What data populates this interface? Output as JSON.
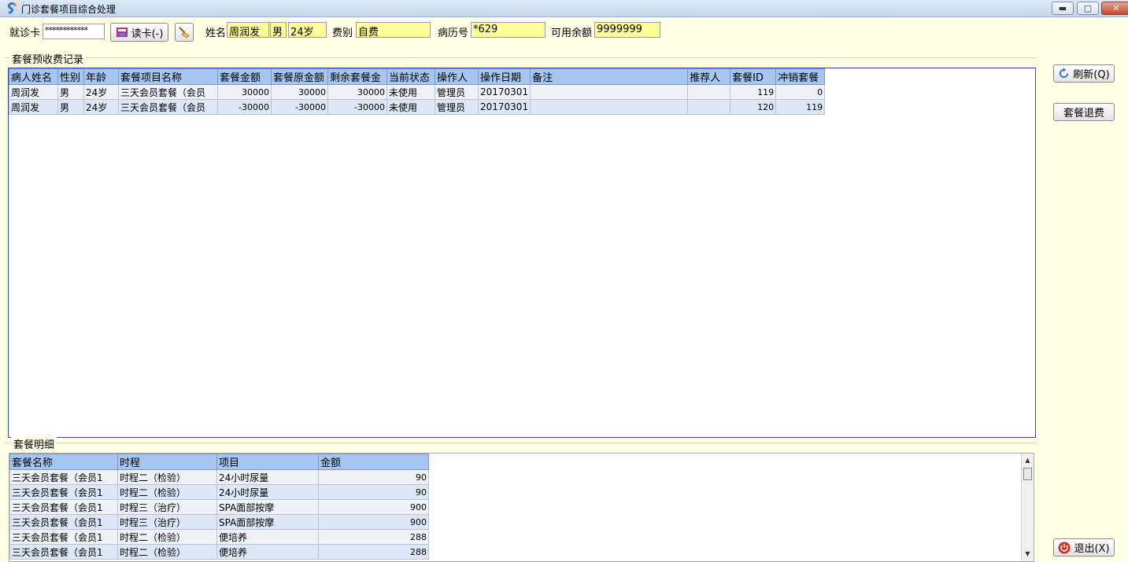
{
  "window": {
    "title": "门诊套餐项目综合处理",
    "minimize_label": "▬",
    "maximize_label": "▢",
    "close_label": "✕"
  },
  "toolbar": {
    "card_label": "就诊卡",
    "card_value": "************",
    "read_card_label": "读卡(-)",
    "name_label": "姓名",
    "name_value": "周润发",
    "gender_value": "男",
    "age_value": "24岁",
    "fee_type_label": "费别",
    "fee_type_value": "自费",
    "record_no_label": "病历号",
    "record_no_value": "*629",
    "balance_label": "可用余额",
    "balance_value": "9999999"
  },
  "records_group": {
    "title": "套餐预收费记录",
    "columns": [
      "病人姓名",
      "性别",
      "年龄",
      "套餐项目名称",
      "套餐金额",
      "套餐原金额",
      "剩余套餐金",
      "当前状态",
      "操作人",
      "操作日期",
      "备注",
      "推荐人",
      "套餐ID",
      "冲销套餐"
    ],
    "rows": [
      [
        "周润发",
        "男",
        "24岁",
        "三天会员套餐（会员",
        "30000",
        "30000",
        "30000",
        "未使用",
        "管理员",
        "20170301",
        "",
        "",
        "119",
        "0"
      ],
      [
        "周润发",
        "男",
        "24岁",
        "三天会员套餐（会员",
        "-30000",
        "-30000",
        "-30000",
        "未使用",
        "管理员",
        "20170301",
        "",
        "",
        "120",
        "119"
      ]
    ]
  },
  "details_group": {
    "title": "套餐明细",
    "columns": [
      "套餐名称",
      "时程",
      "项目",
      "金额"
    ],
    "rows": [
      [
        "三天会员套餐（会员1",
        "时程二（检验）",
        "24小时尿量",
        "90"
      ],
      [
        "三天会员套餐（会员1",
        "时程二（检验）",
        "24小时尿量",
        "90"
      ],
      [
        "三天会员套餐（会员1",
        "时程三（治疗）",
        "SPA面部按摩",
        "900"
      ],
      [
        "三天会员套餐（会员1",
        "时程三（治疗）",
        "SPA面部按摩",
        "900"
      ],
      [
        "三天会员套餐（会员1",
        "时程二（检验）",
        "便培养",
        "288"
      ],
      [
        "三天会员套餐（会员1",
        "时程二（检验）",
        "便培养",
        "288"
      ]
    ]
  },
  "side_buttons": {
    "refresh_label": "刷新(Q)",
    "refund_label": "套餐退费",
    "exit_label": "退出(X)"
  },
  "colors": {
    "background": "#FFFFE6",
    "input_yellow": "#FFFF99",
    "grid_header": "#A5C6F0",
    "grid_border": "#2B4D9C"
  }
}
